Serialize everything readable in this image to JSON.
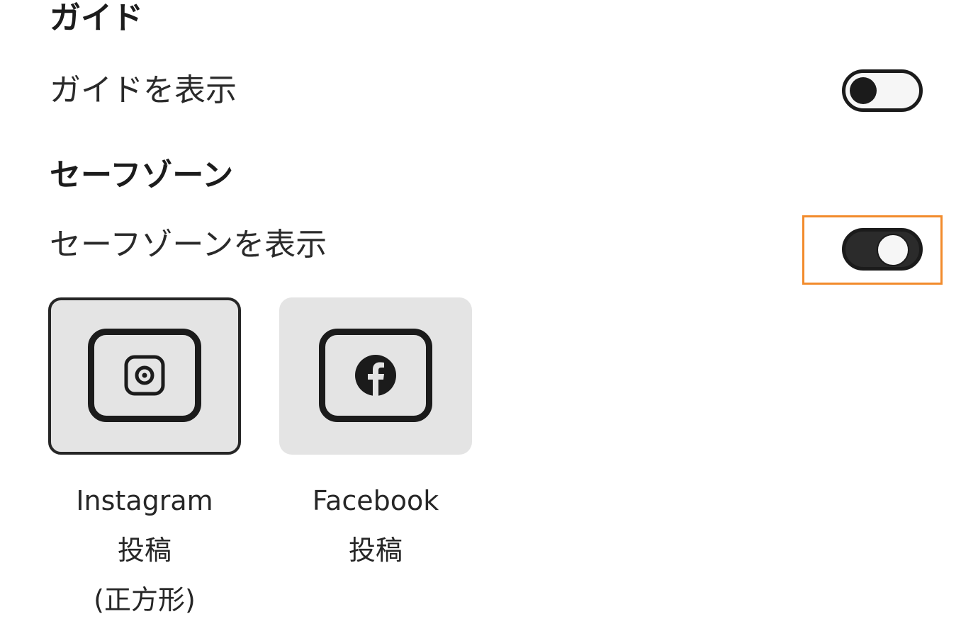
{
  "guide": {
    "title": "ガイド",
    "show_label": "ガイドを表示",
    "enabled": false
  },
  "safe_zone": {
    "title": "セーフゾーン",
    "show_label": "セーフゾーンを表示",
    "enabled": true,
    "highlight_color": "#f28b2c",
    "options": [
      {
        "name": "Instagram",
        "line2": "投稿",
        "line3": "(正方形)",
        "icon": "instagram-icon",
        "selected": true
      },
      {
        "name": "Facebook",
        "line2": "投稿",
        "line3": "",
        "icon": "facebook-icon",
        "selected": false
      }
    ]
  }
}
